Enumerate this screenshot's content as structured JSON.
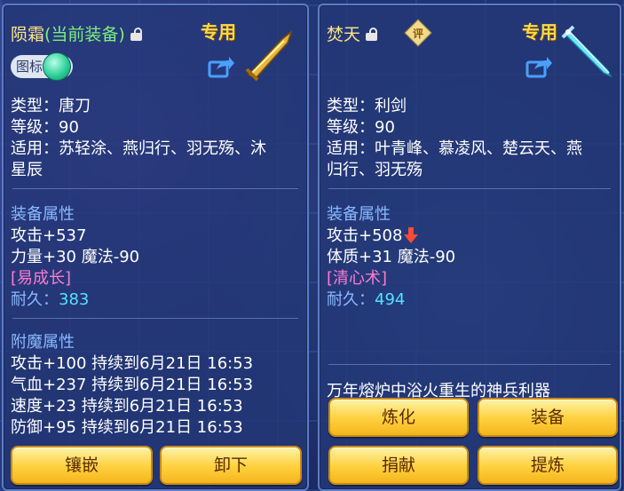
{
  "left": {
    "name": "陨霜",
    "name_tag": "(当前装备)",
    "exclusive": "专用",
    "icon_toggle_label": "图标",
    "type": "类型：唐刀",
    "level": "等级：90",
    "suitable_line1": "适用：苏轻涂、燕归行、羽无殇、沐",
    "suitable_line2": "星辰",
    "equip_section": "装备属性",
    "attack": "攻击+537",
    "stats": "力量+30 魔法-90",
    "skill": "[易成长]",
    "durability_label": "耐久：",
    "durability_value": "383",
    "enchant_section": "附魔属性",
    "enchants": [
      "攻击+100 持续到6月21日 16:53",
      "气血+237 持续到6月21日 16:53",
      "速度+23 持续到6月21日 16:53",
      "防御+95 持续到6月21日 16:53"
    ],
    "buttons": {
      "inlay": "镶嵌",
      "unequip": "卸下"
    }
  },
  "right": {
    "name": "焚天",
    "hint_icon_text": "评",
    "exclusive": "专用",
    "type": "类型：利剑",
    "level": "等级：90",
    "suitable_line1": "适用：叶青峰、慕凌风、楚云天、燕",
    "suitable_line2": "归行、羽无殇",
    "equip_section": "装备属性",
    "attack": "攻击+508",
    "stats": "体质+31 魔法-90",
    "skill": "[清心术]",
    "durability_label": "耐久：",
    "durability_value": "494",
    "flavor": "万年熔炉中浴火重生的神兵利器",
    "buttons": {
      "refine": "炼化",
      "equip": "装备",
      "donate": "捐献",
      "extract": "提炼"
    }
  },
  "colors": {
    "name": "#ffe48a",
    "equipped_tag": "#7cf07c",
    "section": "#8ab8ff",
    "skill": "#ff7ad0",
    "durability": "#56e0ff",
    "button": "#ffd03c",
    "stat_down_arrow": "#ff4a3a"
  },
  "icons": [
    "lock-icon",
    "share-icon",
    "golden-blade-icon",
    "ice-sword-icon",
    "down-arrow-icon",
    "hint-diamond-icon"
  ]
}
